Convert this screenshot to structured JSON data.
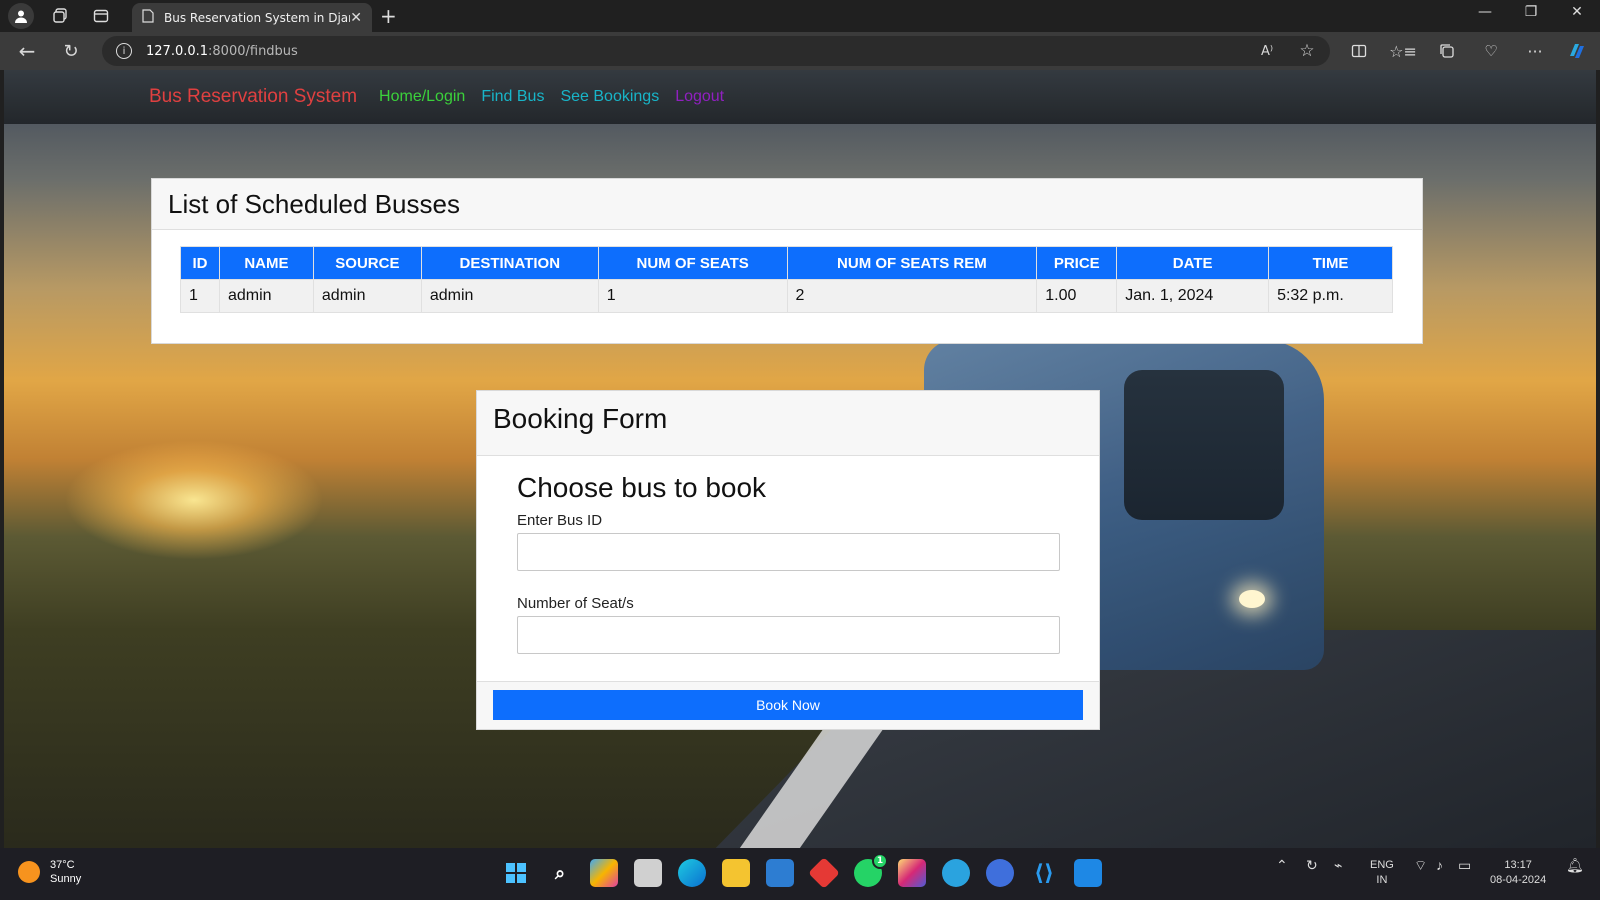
{
  "browser": {
    "tab_title": "Bus Reservation System in Djang",
    "url_host": "127.0.0.1",
    "url_path": ":8000/findbus"
  },
  "navbar": {
    "brand": "Bus Reservation System",
    "links": [
      "Home/Login",
      "Find Bus",
      "See Bookings",
      "Logout"
    ]
  },
  "bus_list": {
    "title": "List of Scheduled Busses",
    "columns": [
      "ID",
      "NAME",
      "SOURCE",
      "DESTINATION",
      "NUM OF SEATS",
      "NUM OF SEATS REM",
      "PRICE",
      "DATE",
      "TIME"
    ],
    "rows": [
      [
        "1",
        "admin",
        "admin",
        "admin",
        "1",
        "2",
        "1.00",
        "Jan. 1, 2024",
        "5:32 p.m."
      ]
    ]
  },
  "booking_form": {
    "title": "Booking Form",
    "heading": "Choose bus to book",
    "bus_id_label": "Enter Bus ID",
    "seats_label": "Number of Seat/s",
    "submit_label": "Book Now"
  },
  "taskbar": {
    "weather_temp": "37°C",
    "weather_desc": "Sunny",
    "lang_top": "ENG",
    "lang_bottom": "IN",
    "time": "13:17",
    "date": "08-04-2024",
    "whatsapp_badge": "1"
  },
  "colors": {
    "primary": "#0d6efd",
    "brand": "#e04040",
    "nav_home": "#3bd13b",
    "nav_link": "#18b5c8",
    "nav_logout": "#9020c0"
  }
}
